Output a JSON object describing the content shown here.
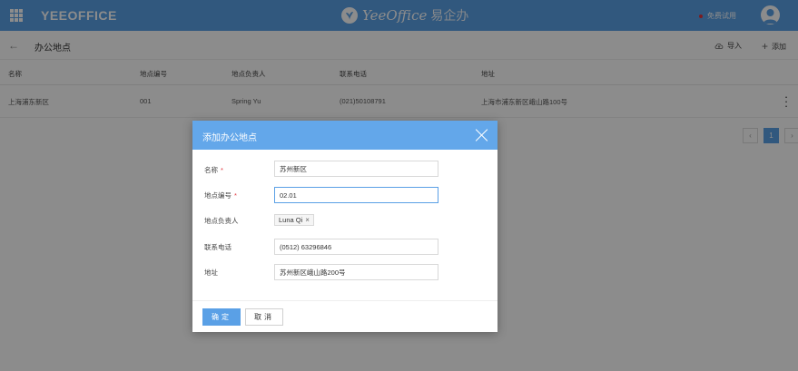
{
  "topbar": {
    "app_name": "YEEOFFICE",
    "brand_name": "YeeOffice",
    "brand_cn": "易企办",
    "trial_label": "免费试用",
    "accent_color": "#5aa0e6"
  },
  "subbar": {
    "title": "办公地点",
    "back_icon": "arrow-left-icon",
    "import_label": "导入",
    "add_label": "添加"
  },
  "table": {
    "headers": [
      "名称",
      "地点编号",
      "地点负责人",
      "联系电话",
      "地址"
    ],
    "rows": [
      [
        "上海浦东新区",
        "001",
        "Spring Yu",
        "(021)50108791",
        "上海市浦东新区峨山路100号"
      ]
    ]
  },
  "pagination": {
    "current": "1"
  },
  "modal": {
    "title": "添加办公地点",
    "fields": [
      {
        "label": "名称",
        "required": "*",
        "value": "苏州新区"
      },
      {
        "label": "地点编号",
        "required": "*",
        "value": "02.01"
      },
      {
        "label": "地点负责人",
        "required": "",
        "tag": "Luna Qi"
      },
      {
        "label": "联系电话",
        "required": "",
        "value": "(0512) 63296846"
      },
      {
        "label": "地址",
        "required": "",
        "value": "苏州新区峨山路200号"
      }
    ],
    "ok_label": "确定",
    "cancel_label": "取消"
  }
}
